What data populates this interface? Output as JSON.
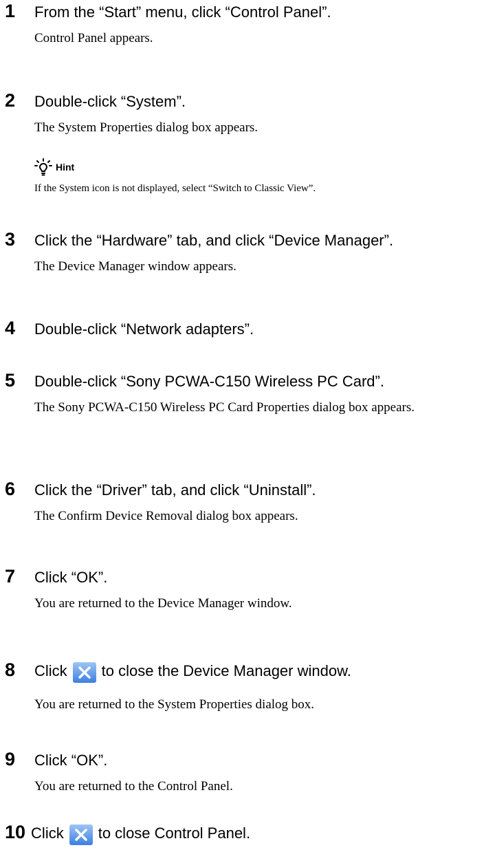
{
  "steps": [
    {
      "num": "1",
      "title": "From the “Start” menu, click “Control Panel”.",
      "desc": "Control Panel appears."
    },
    {
      "num": "2",
      "title": "Double-click “System”.",
      "desc": "The System Properties dialog box appears."
    },
    {
      "num": "3",
      "title": "Click the “Hardware” tab, and click “Device Manager”.",
      "desc": "The Device Manager window appears."
    },
    {
      "num": "4",
      "title": "Double-click “Network adapters”."
    },
    {
      "num": "5",
      "title": "Double-click “Sony PCWA-C150 Wireless PC Card”.",
      "desc": "The Sony PCWA-C150 Wireless PC Card Properties dialog box appears."
    },
    {
      "num": "6",
      "title": "Click the “Driver” tab, and click “Uninstall”.",
      "desc": "The Confirm Device Removal dialog box appears."
    },
    {
      "num": "7",
      "title": "Click “OK”.",
      "desc": "You are returned to the Device Manager window."
    },
    {
      "num": "8",
      "title_before": "Click",
      "title_after": "to close the Device Manager window.",
      "desc": "You are returned to the System Properties dialog box."
    },
    {
      "num": "9",
      "title": "Click “OK”.",
      "desc": "You are returned to the Control Panel."
    },
    {
      "num": "10",
      "title_before": "Click",
      "title_after": "to close Control Panel."
    }
  ],
  "hint": {
    "label": "Hint",
    "text": "If the System icon is not displayed, select “Switch to Classic View”.",
    "icon": "lightbulb-icon"
  },
  "icons": {
    "close": "close-icon"
  },
  "colors": {
    "close_button_bg": "#3d7fe0",
    "close_button_x": "#ffffff"
  }
}
